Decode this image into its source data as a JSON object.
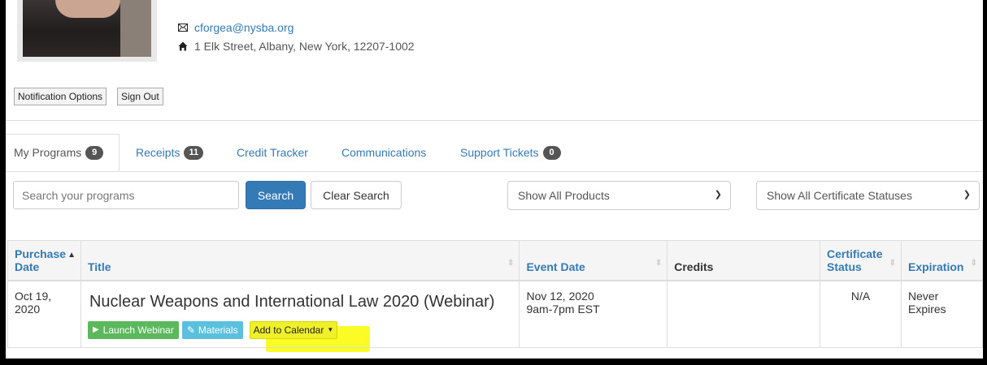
{
  "profile": {
    "email": "cforgea@nysba.org",
    "address": "1 Elk Street, Albany, New York, 12207-1002",
    "email_icon": "envelope-icon",
    "address_icon": "home-icon"
  },
  "account_buttons": {
    "notification": "Notification Options",
    "sign_out": "Sign Out"
  },
  "tabs": [
    {
      "label": "My Programs",
      "count": "9"
    },
    {
      "label": "Receipts",
      "count": "11"
    },
    {
      "label": "Credit Tracker"
    },
    {
      "label": "Communications"
    },
    {
      "label": "Support Tickets",
      "count": "0"
    }
  ],
  "search": {
    "placeholder": "Search your programs",
    "search_label": "Search",
    "clear_label": "Clear Search"
  },
  "filters": {
    "products": "Show All Products",
    "certificates": "Show All Certificate Statuses"
  },
  "table": {
    "headers": {
      "purchase_date": "Purchase Date",
      "title": "Title",
      "event_date": "Event Date",
      "credits": "Credits",
      "certificate_status": "Certificate Status",
      "expiration": "Expiration"
    },
    "rows": [
      {
        "purchase_date": "Oct 19, 2020",
        "title": "Nuclear Weapons and International Law 2020 (Webinar)",
        "launch_label": "Launch Webinar",
        "materials_label": "Materials",
        "calendar_label": "Add to Calendar",
        "event_date": "Nov 12, 2020",
        "event_time": "9am-7pm EST",
        "credits": "",
        "certificate_status": "N/A",
        "expiration": "Never Expires"
      }
    ]
  },
  "colors": {
    "link": "#337ab7",
    "primary": "#337ab7",
    "success": "#5cb85c",
    "info": "#5bc0de",
    "highlight": "#fafa00",
    "badge": "#555555"
  }
}
